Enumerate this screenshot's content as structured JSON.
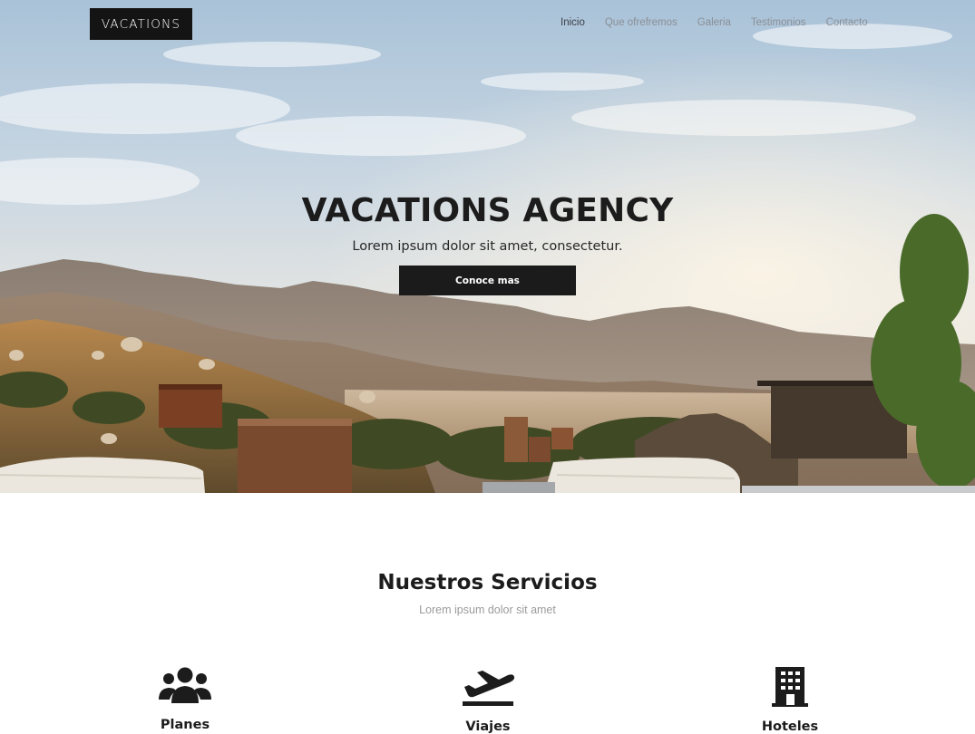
{
  "nav": {
    "brand": "VACATIONS",
    "links": [
      {
        "label": "Inicio",
        "active": true
      },
      {
        "label": "Que ofrefremos",
        "active": false
      },
      {
        "label": "Galeria",
        "active": false
      },
      {
        "label": "Testimonios",
        "active": false
      },
      {
        "label": "Contacto",
        "active": false
      }
    ]
  },
  "hero": {
    "title": "VACATIONS AGENCY",
    "subtitle": "Lorem ipsum dolor sit amet, consectetur.",
    "button_label": "Conoce mas"
  },
  "services": {
    "title": "Nuestros Servicios",
    "subtitle": "Lorem ipsum dolor sit amet",
    "items": [
      {
        "label": "Planes",
        "icon": "users-icon"
      },
      {
        "label": "Viajes",
        "icon": "plane-departure-icon"
      },
      {
        "label": "Hoteles",
        "icon": "building-icon"
      }
    ]
  },
  "colors": {
    "brand_bg": "#141414",
    "button_bg": "#1b1b1b",
    "nav_active": "#3c4149",
    "nav_inactive": "#8a8f96",
    "muted_text": "#9b9b9b"
  }
}
